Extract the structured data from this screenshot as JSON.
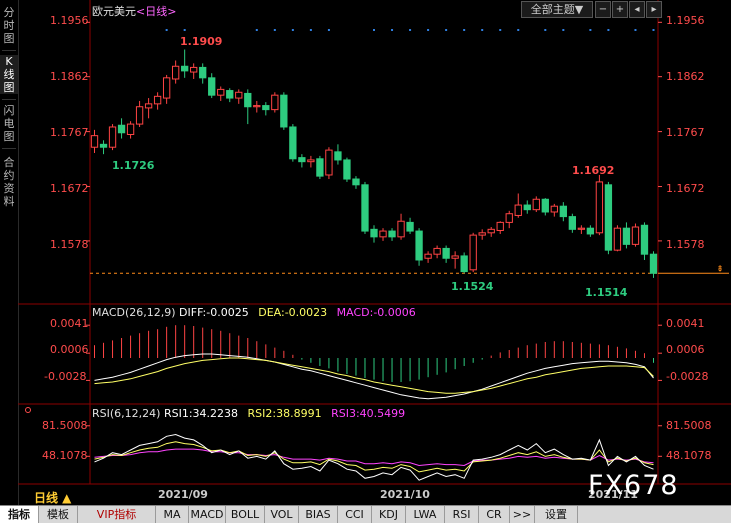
{
  "sidebar": {
    "tabs": [
      {
        "label": "分时图",
        "active": false
      },
      {
        "label": "K线图",
        "active": true
      },
      {
        "label": "闪电图",
        "active": false
      },
      {
        "label": "合约资料",
        "active": false
      }
    ]
  },
  "header": {
    "instrument": "欧元美元",
    "period": "<日线>",
    "theme_button": "全部主题▼"
  },
  "price_axis": {
    "ticks": [
      "1.1956",
      "1.1862",
      "1.1767",
      "1.1672",
      "1.1578"
    ]
  },
  "annotations": {
    "high": "1.1909",
    "low_left": "1.1726",
    "high_right": "1.1692",
    "low_mid": "1.1524",
    "low_right": "1.1514"
  },
  "macd": {
    "label": "MACD(26,12,9)",
    "diff": "DIFF:-0.0025",
    "dea": "DEA:-0.0023",
    "macd": "MACD:-0.0006",
    "ticks": [
      "0.0041",
      "0.0006",
      "-0.0028"
    ]
  },
  "rsi": {
    "label": "RSI(6,12,24)",
    "rsi1": "RSI1:34.2238",
    "rsi2": "RSI2:38.8991",
    "rsi3": "RSI3:40.5499",
    "ticks": [
      "81.5008",
      "48.1078"
    ]
  },
  "time_axis": [
    "2021/09",
    "2021/10",
    "2021/11"
  ],
  "period_selector": "日线 ▲",
  "bottom_tabs": [
    "指标",
    "模板",
    "VIP指标",
    "MA",
    "MACD",
    "BOLL",
    "VOL",
    "BIAS",
    "CCI",
    "KDJ",
    "LWA",
    "RSI",
    "CR",
    ">>",
    "设置"
  ],
  "watermark": "FX678",
  "colors": {
    "up": "#ff4444",
    "down": "#2ecc80",
    "diff_line": "#ffffff",
    "dea_line": "#ffff66",
    "rsi3_line": "#ff44ff",
    "axis_text": "#ff4c4c",
    "grid": "#8b0000",
    "dots": "#2f7fe0"
  },
  "chart_data": {
    "type": "candlestick",
    "candles": [
      [
        1.174,
        1.176,
        1.173,
        1.177
      ],
      [
        1.1745,
        1.174,
        1.1728,
        1.1752
      ],
      [
        1.174,
        1.1775,
        1.1735,
        1.178
      ],
      [
        1.1778,
        1.1765,
        1.1755,
        1.179
      ],
      [
        1.1762,
        1.178,
        1.1755,
        1.1785
      ],
      [
        1.178,
        1.181,
        1.1775,
        1.182
      ],
      [
        1.1808,
        1.1815,
        1.179,
        1.1825
      ],
      [
        1.1815,
        1.1828,
        1.1805,
        1.1835
      ],
      [
        1.1825,
        1.186,
        1.1815,
        1.1865
      ],
      [
        1.1858,
        1.188,
        1.185,
        1.189
      ],
      [
        1.188,
        1.1872,
        1.186,
        1.1909
      ],
      [
        1.187,
        1.1878,
        1.1858,
        1.1885
      ],
      [
        1.1878,
        1.186,
        1.185,
        1.1885
      ],
      [
        1.186,
        1.183,
        1.1825,
        1.1868
      ],
      [
        1.183,
        1.184,
        1.182,
        1.1845
      ],
      [
        1.1838,
        1.1825,
        1.1818,
        1.1842
      ],
      [
        1.1825,
        1.1835,
        1.1815,
        1.184
      ],
      [
        1.1833,
        1.181,
        1.178,
        1.184
      ],
      [
        1.181,
        1.1812,
        1.18,
        1.182
      ],
      [
        1.1812,
        1.1805,
        1.1795,
        1.1818
      ],
      [
        1.1805,
        1.183,
        1.18,
        1.1835
      ],
      [
        1.183,
        1.1775,
        1.177,
        1.1835
      ],
      [
        1.1775,
        1.172,
        1.1715,
        1.178
      ],
      [
        1.1722,
        1.1715,
        1.1705,
        1.1728
      ],
      [
        1.1715,
        1.1718,
        1.1705,
        1.1725
      ],
      [
        1.172,
        1.169,
        1.1685,
        1.1725
      ],
      [
        1.1692,
        1.1735,
        1.1685,
        1.174
      ],
      [
        1.1732,
        1.1718,
        1.171,
        1.1745
      ],
      [
        1.1718,
        1.1685,
        1.168,
        1.1722
      ],
      [
        1.1685,
        1.1675,
        1.1668,
        1.169
      ],
      [
        1.1675,
        1.1595,
        1.159,
        1.168
      ],
      [
        1.1598,
        1.1585,
        1.1575,
        1.1605
      ],
      [
        1.1585,
        1.1595,
        1.1578,
        1.16
      ],
      [
        1.1595,
        1.1585,
        1.1578,
        1.16
      ],
      [
        1.1585,
        1.1612,
        1.158,
        1.1625
      ],
      [
        1.161,
        1.1595,
        1.159,
        1.1618
      ],
      [
        1.1595,
        1.1545,
        1.1535,
        1.16
      ],
      [
        1.1548,
        1.1555,
        1.154,
        1.156
      ],
      [
        1.1555,
        1.1565,
        1.1548,
        1.157
      ],
      [
        1.1565,
        1.1548,
        1.154,
        1.157
      ],
      [
        1.1548,
        1.1552,
        1.153,
        1.156
      ],
      [
        1.1552,
        1.1525,
        1.1522,
        1.1558
      ],
      [
        1.1528,
        1.1588,
        1.1524,
        1.1592
      ],
      [
        1.1588,
        1.1592,
        1.158,
        1.1598
      ],
      [
        1.1592,
        1.1598,
        1.1585,
        1.1602
      ],
      [
        1.1596,
        1.161,
        1.159,
        1.1612
      ],
      [
        1.161,
        1.1625,
        1.16,
        1.163
      ],
      [
        1.1622,
        1.164,
        1.1618,
        1.166
      ],
      [
        1.164,
        1.1632,
        1.1625,
        1.1648
      ],
      [
        1.1632,
        1.165,
        1.1628,
        1.1655
      ],
      [
        1.165,
        1.1628,
        1.1622,
        1.1652
      ],
      [
        1.1628,
        1.1638,
        1.162,
        1.1642
      ],
      [
        1.1638,
        1.162,
        1.1612,
        1.1645
      ],
      [
        1.162,
        1.1598,
        1.1592,
        1.1625
      ],
      [
        1.1598,
        1.16,
        1.159,
        1.1605
      ],
      [
        1.16,
        1.159,
        1.1585,
        1.1605
      ],
      [
        1.1592,
        1.168,
        1.1588,
        1.1692
      ],
      [
        1.1675,
        1.1562,
        1.1555,
        1.168
      ],
      [
        1.1562,
        1.16,
        1.156,
        1.1605
      ],
      [
        1.16,
        1.1572,
        1.1565,
        1.161
      ],
      [
        1.1572,
        1.1602,
        1.1568,
        1.1608
      ],
      [
        1.1605,
        1.1555,
        1.1545,
        1.161
      ],
      [
        1.1555,
        1.1522,
        1.1514,
        1.156
      ]
    ],
    "candle_format": [
      "open",
      "close",
      "low",
      "high"
    ],
    "macd_hist": [
      0.0016,
      0.0019,
      0.0022,
      0.0025,
      0.0028,
      0.0031,
      0.0034,
      0.0036,
      0.0039,
      0.0041,
      0.0041,
      0.004,
      0.0038,
      0.0036,
      0.0034,
      0.0031,
      0.0028,
      0.0025,
      0.0021,
      0.0017,
      0.0013,
      0.0009,
      0.0004,
      -0.0002,
      -0.0006,
      -0.001,
      -0.0013,
      -0.0017,
      -0.002,
      -0.0022,
      -0.0025,
      -0.0027,
      -0.0029,
      -0.003,
      -0.003,
      -0.0029,
      -0.0027,
      -0.0024,
      -0.0021,
      -0.0018,
      -0.0014,
      -0.001,
      -0.0006,
      -0.0002,
      0.0003,
      0.0007,
      0.001,
      0.0013,
      0.0016,
      0.0018,
      0.002,
      0.0021,
      0.0021,
      0.002,
      0.0019,
      0.0018,
      0.0017,
      0.0016,
      0.0014,
      0.0012,
      0.0009,
      0.0006,
      -0.0006
    ],
    "diff": [
      -0.0028,
      -0.0026,
      -0.0024,
      -0.0021,
      -0.0018,
      -0.0014,
      -0.001,
      -0.0006,
      -0.0002,
      0.0001,
      0.0003,
      0.0004,
      0.0005,
      0.0005,
      0.0004,
      0.0003,
      0.0002,
      0.0001,
      -0.0001,
      -0.0003,
      -0.0005,
      -0.0008,
      -0.0011,
      -0.0014,
      -0.0016,
      -0.0019,
      -0.0022,
      -0.0025,
      -0.0028,
      -0.0031,
      -0.0034,
      -0.0037,
      -0.004,
      -0.0043,
      -0.0046,
      -0.0048,
      -0.005,
      -0.0051,
      -0.005,
      -0.0049,
      -0.0047,
      -0.0045,
      -0.0042,
      -0.0039,
      -0.0035,
      -0.0031,
      -0.0027,
      -0.0023,
      -0.0019,
      -0.0016,
      -0.0013,
      -0.0011,
      -0.0009,
      -0.0007,
      -0.0006,
      -0.0005,
      -0.0004,
      -0.0004,
      -0.0005,
      -0.0006,
      -0.0008,
      -0.0011,
      -0.0025
    ],
    "dea": [
      -0.0032,
      -0.0031,
      -0.003,
      -0.0028,
      -0.0026,
      -0.0023,
      -0.002,
      -0.0017,
      -0.0013,
      -0.001,
      -0.0007,
      -0.0005,
      -0.0003,
      -0.0002,
      -0.0001,
      0.0,
      0.0,
      -0.0001,
      -0.0002,
      -0.0003,
      -0.0005,
      -0.0007,
      -0.0009,
      -0.0011,
      -0.0013,
      -0.0015,
      -0.0017,
      -0.002,
      -0.0022,
      -0.0025,
      -0.0027,
      -0.003,
      -0.0032,
      -0.0034,
      -0.0036,
      -0.0038,
      -0.004,
      -0.0042,
      -0.0043,
      -0.0044,
      -0.0044,
      -0.0043,
      -0.0042,
      -0.004,
      -0.0038,
      -0.0035,
      -0.0032,
      -0.0029,
      -0.0026,
      -0.0024,
      -0.0021,
      -0.0019,
      -0.0017,
      -0.0015,
      -0.0013,
      -0.0012,
      -0.0011,
      -0.001,
      -0.001,
      -0.001,
      -0.0011,
      -0.0012,
      -0.0023
    ],
    "rsi1": [
      42,
      46,
      52,
      50,
      55,
      60,
      62,
      64,
      70,
      72,
      68,
      66,
      60,
      52,
      55,
      50,
      54,
      46,
      48,
      45,
      54,
      40,
      34,
      35,
      37,
      32,
      44,
      40,
      34,
      32,
      24,
      26,
      30,
      28,
      36,
      33,
      22,
      26,
      30,
      26,
      28,
      24,
      44,
      45,
      47,
      50,
      55,
      60,
      55,
      62,
      52,
      56,
      50,
      45,
      46,
      44,
      66,
      38,
      48,
      42,
      48,
      38,
      34
    ],
    "rsi2": [
      45,
      47,
      50,
      49,
      52,
      55,
      57,
      58,
      62,
      64,
      62,
      61,
      58,
      54,
      55,
      52,
      54,
      49,
      50,
      48,
      52,
      45,
      41,
      41,
      42,
      39,
      45,
      43,
      39,
      38,
      33,
      34,
      36,
      35,
      39,
      37,
      31,
      33,
      35,
      33,
      34,
      32,
      42,
      43,
      44,
      46,
      49,
      52,
      50,
      53,
      48,
      50,
      47,
      45,
      45,
      44,
      55,
      42,
      46,
      43,
      46,
      41,
      39
    ],
    "rsi3": [
      47,
      48,
      49,
      49,
      50,
      52,
      53,
      53,
      55,
      56,
      56,
      56,
      55,
      53,
      53,
      52,
      52,
      50,
      50,
      49,
      50,
      47,
      45,
      45,
      45,
      44,
      46,
      45,
      43,
      43,
      40,
      40,
      41,
      40,
      42,
      41,
      38,
      39,
      40,
      39,
      39,
      38,
      43,
      44,
      44,
      45,
      46,
      48,
      47,
      48,
      46,
      47,
      46,
      45,
      45,
      44,
      49,
      44,
      45,
      44,
      45,
      42,
      41
    ],
    "price_ylim": [
      1.15,
      1.196
    ],
    "macd_ylim": [
      -0.005,
      0.005
    ],
    "rsi_ylim": [
      20,
      90
    ]
  }
}
